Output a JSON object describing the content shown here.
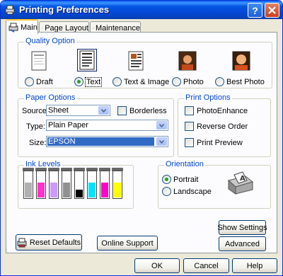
{
  "window": {
    "title": "Printing Preferences"
  },
  "tabs": [
    {
      "label": "Main"
    },
    {
      "label": "Page Layout"
    },
    {
      "label": "Maintenance"
    }
  ],
  "quality": {
    "title": "Quality Option",
    "options": [
      {
        "label": "Draft"
      },
      {
        "label": "Text"
      },
      {
        "label": "Text & Image"
      },
      {
        "label": "Photo"
      },
      {
        "label": "Best Photo"
      }
    ]
  },
  "paper": {
    "title": "Paper Options",
    "source_label": "Source:",
    "source_value": "Sheet",
    "borderless_label": "Borderless",
    "type_label": "Type:",
    "type_value": "Plain Paper",
    "size_label": "Size:",
    "size_value": "EPSON"
  },
  "print_options": {
    "title": "Print Options",
    "photoenhance": "PhotoEnhance",
    "reverse": "Reverse Order",
    "preview": "Print Preview"
  },
  "ink": {
    "title": "Ink Levels",
    "levels": [
      {
        "color": "#B0B0B0",
        "level": 0.55
      },
      {
        "color": "#FF33CC",
        "level": 0.55
      },
      {
        "color": "#CC99FF",
        "level": 0.55
      },
      {
        "color": "#909090",
        "level": 0.55
      },
      {
        "color": "#000000",
        "level": 0.3
      },
      {
        "color": "#00E5FF",
        "level": 0.55
      },
      {
        "color": "#FF00CC",
        "level": 0.55
      },
      {
        "color": "#FFFF00",
        "level": 0.55
      }
    ]
  },
  "orientation": {
    "title": "Orientation",
    "portrait": "Portrait",
    "landscape": "Landscape"
  },
  "buttons": {
    "reset": "Reset Defaults",
    "online": "Online Support",
    "show_settings": "Show Settings",
    "advanced": "Advanced",
    "ok": "OK",
    "cancel": "Cancel",
    "help": "Help"
  }
}
